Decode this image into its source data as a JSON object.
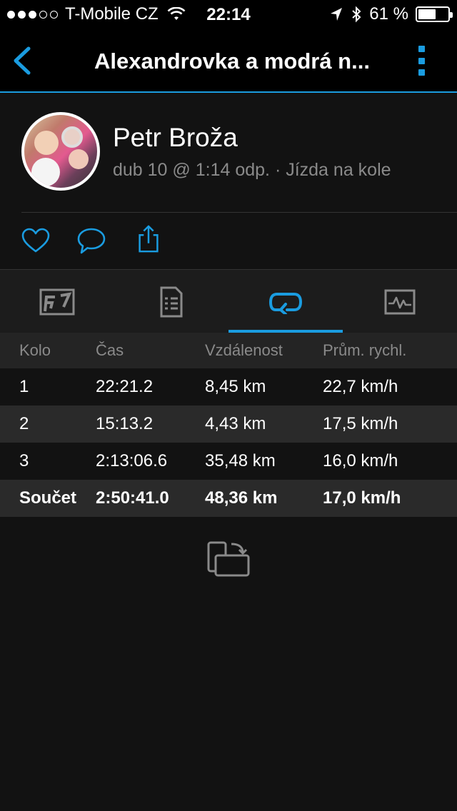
{
  "status_bar": {
    "carrier": "T-Mobile CZ",
    "time": "22:14",
    "battery": "61 %",
    "battery_level": 0.61,
    "signal_bars": 3,
    "signal_total": 5
  },
  "nav": {
    "title": "Alexandrovka a modrá n...",
    "accent_color": "#1a9ce0"
  },
  "activity": {
    "user_name": "Petr Broža",
    "meta": "dub 10 @ 1:14 odp. · Jízda na kole"
  },
  "actions": [
    "like-icon",
    "comment-icon",
    "share-icon"
  ],
  "tabs": [
    {
      "icon": "map-icon",
      "active": false
    },
    {
      "icon": "details-icon",
      "active": false
    },
    {
      "icon": "laps-icon",
      "active": true
    },
    {
      "icon": "chart-icon",
      "active": false
    }
  ],
  "laps": {
    "headers": [
      "Kolo",
      "Čas",
      "Vzdálenost",
      "Prům. rychl."
    ],
    "rows": [
      [
        "1",
        "22:21.2",
        "8,45 km",
        "22,7 km/h"
      ],
      [
        "2",
        "15:13.2",
        "4,43 km",
        "17,5 km/h"
      ],
      [
        "3",
        "2:13:06.6",
        "35,48 km",
        "16,0 km/h"
      ]
    ],
    "total": [
      "Součet",
      "2:50:41.0",
      "48,36 km",
      "17,0 km/h"
    ]
  }
}
